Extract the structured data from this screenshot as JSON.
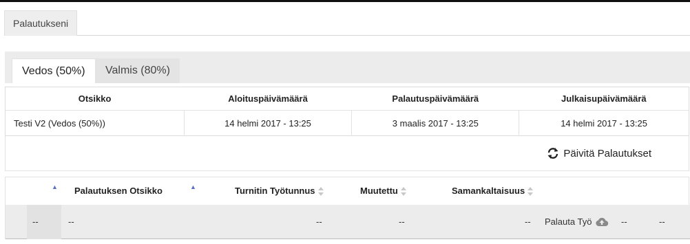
{
  "top_tabs": [
    {
      "label": "Palautukseni"
    }
  ],
  "sub_tabs": [
    {
      "label": "Vedos (50%)",
      "active": true
    },
    {
      "label": "Valmis (80%)",
      "active": false
    }
  ],
  "assignment_table": {
    "headers": [
      "Otsikko",
      "Aloituspäivämäärä",
      "Palautuspäivämäärä",
      "Julkaisupäivämäärä"
    ],
    "row": [
      "Testi V2 (Vedos (50%))",
      "14 helmi 2017 - 13:25",
      "3 maalis 2017 - 13:25",
      "14 helmi 2017 - 13:25"
    ]
  },
  "refresh": {
    "label": "Päivitä Palautukset",
    "icon": "refresh-icon"
  },
  "submission_table": {
    "headers": {
      "title": "Palautuksen Otsikko",
      "turnitin_id": "Turnitin Työtunnus",
      "modified": "Muutettu",
      "similarity": "Samankaltaisuus"
    },
    "row": {
      "first": "--",
      "title": "--",
      "turnitin_id": "--",
      "modified": "--",
      "similarity": "--",
      "return_label": "Palauta Työ",
      "return_icon": "cloud-upload-icon",
      "extra1": "--",
      "extra2": "--"
    }
  },
  "colors": {
    "accent_sort": "#5b6fc8",
    "panel_bg": "#ececec"
  }
}
